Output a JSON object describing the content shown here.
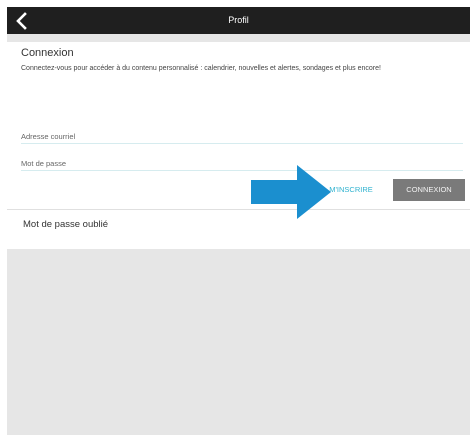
{
  "topbar": {
    "title": "Profil",
    "back_icon": "chevron-left-icon"
  },
  "login": {
    "title": "Connexion",
    "description": "Connectez-vous pour accéder à du contenu personnalisé : calendrier, nouvelles et alertes, sondages et plus encore!",
    "email_placeholder": "Adresse courriel",
    "email_value": "",
    "password_placeholder": "Mot de passe",
    "password_value": "",
    "signup_label": "M'INSCRIRE",
    "login_label": "CONNEXION"
  },
  "forgot": {
    "label": "Mot de passe oublié"
  },
  "colors": {
    "topbar_bg": "#1f1f1f",
    "accent": "#2fb2cf",
    "annotation_arrow": "#1b8fcf",
    "login_button_bg": "#7a7a7a",
    "page_bg": "#e6e6e6"
  }
}
